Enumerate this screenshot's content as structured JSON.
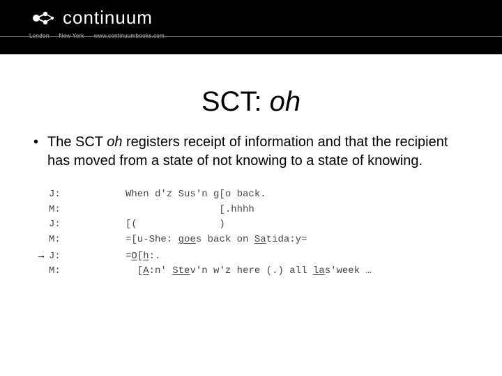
{
  "header": {
    "brand_name": "continuum",
    "sub_left": "London",
    "sub_mid": "New York",
    "sub_url": "www.continuumbooks.com"
  },
  "title": {
    "prefix": "SCT: ",
    "italic": "oh"
  },
  "bullet": {
    "pre": "The SCT ",
    "italic": "oh",
    "post": " registers receipt of information and that the recipient has moved from a state of not knowing to a state of knowing."
  },
  "transcript": {
    "rows": [
      {
        "arrow": "",
        "speaker": "J:",
        "utt_plain": "When d'z Sus'n g[o back."
      },
      {
        "arrow": "",
        "speaker": "M:",
        "utt_plain": "                [.hhhh"
      },
      {
        "arrow": "",
        "speaker": "J:",
        "utt_plain": "[(              )"
      },
      {
        "arrow": "",
        "speaker": "M:",
        "utt_html": "=[u-She: <span class=\"u\">goe</span>s back on <span class=\"u\">Sa</span>tida:y="
      },
      {
        "arrow": "→",
        "speaker": "J:",
        "utt_html": "=<span class=\"u\">O</span>[<span class=\"u\">h</span>:."
      },
      {
        "arrow": "",
        "speaker": "M:",
        "utt_html": "  [<span class=\"u\">A</span>:n' <span class=\"u\">Ste</span>v'n w'z here (.) all <span class=\"u\">la</span>s'week …"
      }
    ]
  }
}
